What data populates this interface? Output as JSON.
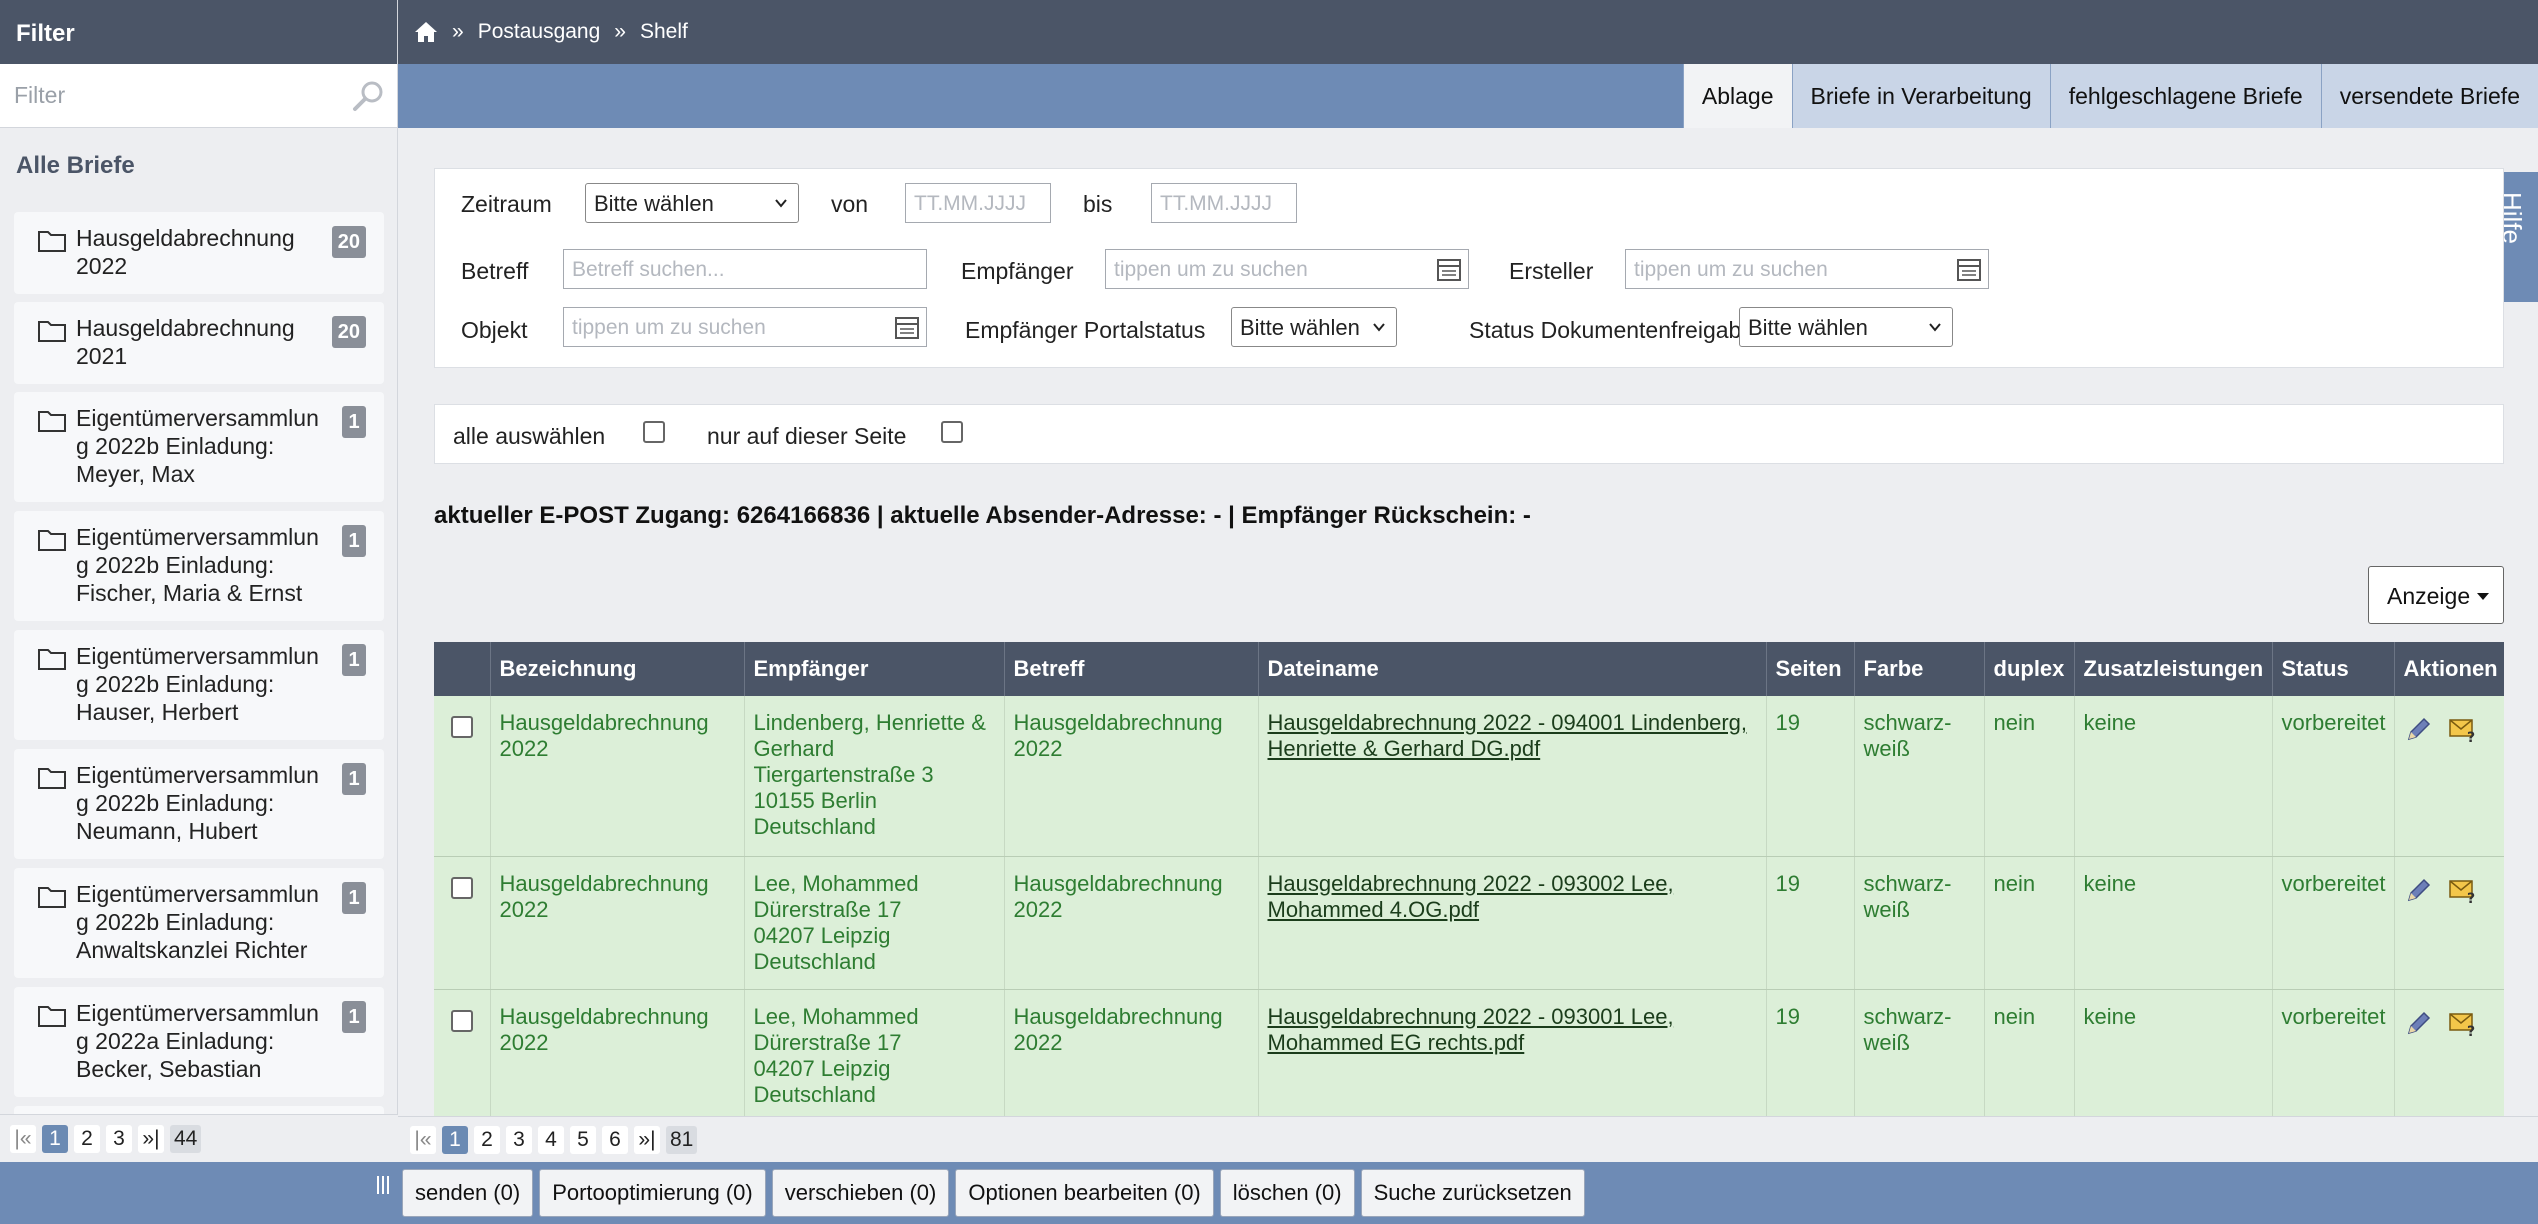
{
  "sidebar": {
    "header": "Filter",
    "filter_placeholder": "Filter",
    "section_title": "Alle Briefe",
    "folders": [
      {
        "line1": "Hausgeldabrechnung",
        "line2": "2022",
        "line3": "",
        "count": "20"
      },
      {
        "line1": "Hausgeldabrechnung",
        "line2": "2021",
        "line3": "",
        "count": "20"
      },
      {
        "line1": "Eigentümerversammlun",
        "line2": "g 2022b Einladung:",
        "line3": "Meyer, Max",
        "count": "1"
      },
      {
        "line1": "Eigentümerversammlun",
        "line2": "g 2022b Einladung:",
        "line3": "Fischer, Maria & Ernst",
        "count": "1"
      },
      {
        "line1": "Eigentümerversammlun",
        "line2": "g 2022b Einladung:",
        "line3": "Hauser, Herbert",
        "count": "1"
      },
      {
        "line1": "Eigentümerversammlun",
        "line2": "g 2022b Einladung:",
        "line3": "Neumann, Hubert",
        "count": "1"
      },
      {
        "line1": "Eigentümerversammlun",
        "line2": "g 2022b Einladung:",
        "line3": "Anwaltskanzlei Richter",
        "count": "1"
      },
      {
        "line1": "Eigentümerversammlun",
        "line2": "g 2022a Einladung:",
        "line3": "Becker, Sebastian",
        "count": "1"
      }
    ],
    "pager": {
      "first": "|«",
      "pages": [
        "1",
        "2",
        "3"
      ],
      "last": "»|",
      "total": "44"
    }
  },
  "breadcrumb": {
    "sep": "»",
    "items": [
      "Postausgang",
      "Shelf"
    ]
  },
  "tabs": [
    "Ablage",
    "Briefe in Verarbeitung",
    "fehlgeschlagene Briefe",
    "versendete Briefe"
  ],
  "help_label": "Hilfe",
  "filters": {
    "zeitraum_label": "Zeitraum",
    "zeitraum_value": "Bitte wählen",
    "von_label": "von",
    "von_placeholder": "TT.MM.JJJJ",
    "bis_label": "bis",
    "bis_placeholder": "TT.MM.JJJJ",
    "betreff_label": "Betreff",
    "betreff_placeholder": "Betreff suchen...",
    "empfaenger_label": "Empfänger",
    "empfaenger_placeholder": "tippen um zu suchen",
    "ersteller_label": "Ersteller",
    "ersteller_placeholder": "tippen um zu suchen",
    "objekt_label": "Objekt",
    "objekt_placeholder": "tippen um zu suchen",
    "portalstatus_label": "Empfänger Portalstatus",
    "portalstatus_value": "Bitte wählen",
    "freigabe_label": "Status Dokumentenfreigabe",
    "freigabe_value": "Bitte wählen"
  },
  "selection": {
    "all_label": "alle auswählen",
    "page_label": "nur auf dieser Seite"
  },
  "info_line": "aktueller E-POST Zugang: 6264166836 | aktuelle Absender-Adresse: - | Empfänger Rückschein: -",
  "anzeige_label": "Anzeige",
  "table": {
    "headers": [
      "",
      "Bezeichnung",
      "Empfänger",
      "Betreff",
      "Dateiname",
      "Seiten",
      "Farbe",
      "duplex",
      "Zusatzleistungen",
      "Status",
      "Aktionen"
    ],
    "rows": [
      {
        "bez1": "Hausgeldabrechnung",
        "bez2": "2022",
        "emp1": "Lindenberg, Henriette &",
        "emp2": "Gerhard",
        "emp3": "Tiergartenstraße 3",
        "emp4": "10155 Berlin",
        "emp5": "Deutschland",
        "bet1": "Hausgeldabrechnung",
        "bet2": "2022",
        "file1": "Hausgeldabrechnung 2022 - 094001 Lindenberg,",
        "file2": "Henriette & Gerhard DG.pdf",
        "seiten": "19",
        "farbe1": "schwarz-",
        "farbe2": "weiß",
        "duplex": "nein",
        "zusatz": "keine",
        "status": "vorbereitet"
      },
      {
        "bez1": "Hausgeldabrechnung",
        "bez2": "2022",
        "emp1": "Lee, Mohammed",
        "emp2": "Dürerstraße 17",
        "emp3": "04207 Leipzig",
        "emp4": "Deutschland",
        "emp5": "",
        "bet1": "Hausgeldabrechnung",
        "bet2": "2022",
        "file1": "Hausgeldabrechnung 2022 - 093002 Lee,",
        "file2": "Mohammed 4.OG.pdf",
        "seiten": "19",
        "farbe1": "schwarz-",
        "farbe2": "weiß",
        "duplex": "nein",
        "zusatz": "keine",
        "status": "vorbereitet"
      },
      {
        "bez1": "Hausgeldabrechnung",
        "bez2": "2022",
        "emp1": "Lee, Mohammed",
        "emp2": "Dürerstraße 17",
        "emp3": "04207 Leipzig",
        "emp4": "Deutschland",
        "emp5": "",
        "bet1": "Hausgeldabrechnung",
        "bet2": "2022",
        "file1": "Hausgeldabrechnung 2022 - 093001 Lee,",
        "file2": "Mohammed EG rechts.pdf",
        "seiten": "19",
        "farbe1": "schwarz-",
        "farbe2": "weiß",
        "duplex": "nein",
        "zusatz": "keine",
        "status": "vorbereitet"
      }
    ]
  },
  "main_pager": {
    "first": "|«",
    "pages": [
      "1",
      "2",
      "3",
      "4",
      "5",
      "6"
    ],
    "last": "»|",
    "total": "81"
  },
  "buttons": [
    "senden (0)",
    "Portooptimierung (0)",
    "verschieben (0)",
    "Optionen bearbeiten (0)",
    "löschen (0)",
    "Suche zurücksetzen"
  ]
}
